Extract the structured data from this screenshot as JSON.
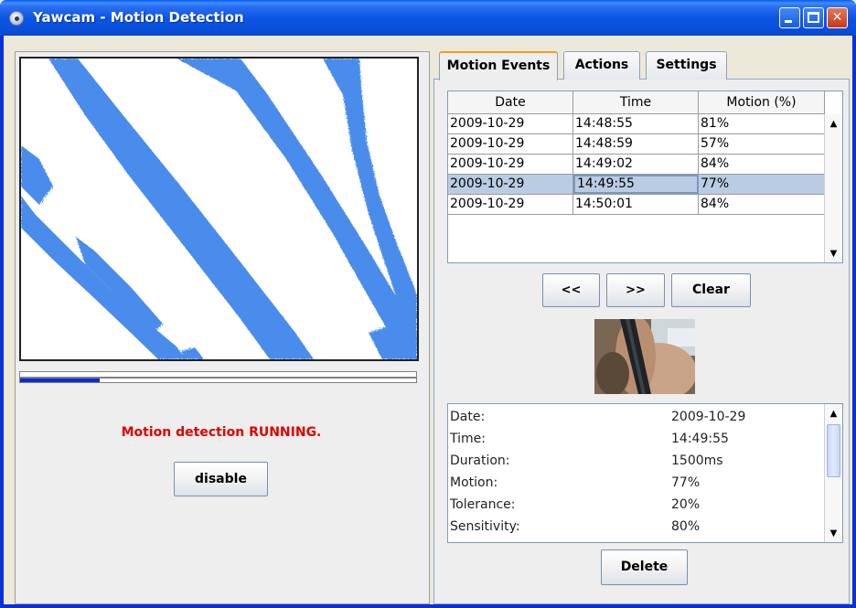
{
  "window": {
    "title": "Yawcam - Motion Detection"
  },
  "left": {
    "status": "Motion detection RUNNING.",
    "disable_label": "disable",
    "progress_fraction": 0.2
  },
  "tabs": [
    {
      "label": "Motion Events",
      "active": true
    },
    {
      "label": "Actions",
      "active": false
    },
    {
      "label": "Settings",
      "active": false
    }
  ],
  "events_table": {
    "headers": [
      "Date",
      "Time",
      "Motion (%)"
    ],
    "rows": [
      [
        "2009-10-29",
        "14:48:55",
        "81%"
      ],
      [
        "2009-10-29",
        "14:48:59",
        "57%"
      ],
      [
        "2009-10-29",
        "14:49:02",
        "84%"
      ],
      [
        "2009-10-29",
        "14:49:55",
        "77%"
      ],
      [
        "2009-10-29",
        "14:50:01",
        "84%"
      ]
    ],
    "selected_row": 3
  },
  "nav": {
    "prev_label": "<<",
    "next_label": ">>",
    "clear_label": "Clear"
  },
  "details": [
    {
      "label": "Date:",
      "value": "2009-10-29"
    },
    {
      "label": "Time:",
      "value": "14:49:55"
    },
    {
      "label": "Duration:",
      "value": "1500ms"
    },
    {
      "label": "Motion:",
      "value": "77%"
    },
    {
      "label": "Tolerance:",
      "value": "20%"
    },
    {
      "label": "Sensitivity:",
      "value": "80%"
    }
  ],
  "delete_label": "Delete",
  "colors": {
    "motion_blue": "#4A8CEB",
    "status_red": "#E00000",
    "titlebar_blue": "#0A4FDC"
  }
}
